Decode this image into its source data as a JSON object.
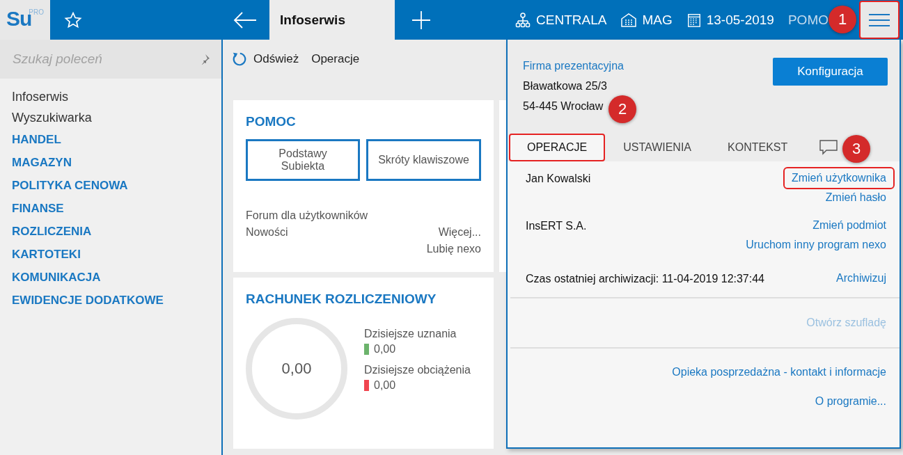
{
  "topbar": {
    "logo_main": "Su",
    "logo_sup": "PRO",
    "tab": "Infoserwis",
    "items": [
      {
        "kind": "branch",
        "label": "CENTRALA"
      },
      {
        "kind": "warehouse",
        "label": "MAG"
      },
      {
        "kind": "date",
        "label": "13-05-2019"
      },
      {
        "kind": "plain",
        "label": "POMO"
      }
    ],
    "menu_highlighted": true
  },
  "sidebar": {
    "search_placeholder": "Szukaj poleceń",
    "items": [
      {
        "label": "Infoserwis",
        "kind": "plain"
      },
      {
        "label": "Wyszukiwarka",
        "kind": "plain"
      },
      {
        "label": "HANDEL",
        "kind": "section"
      },
      {
        "label": "MAGAZYN",
        "kind": "section"
      },
      {
        "label": "POLITYKA CENOWA",
        "kind": "section"
      },
      {
        "label": "FINANSE",
        "kind": "section"
      },
      {
        "label": "ROZLICZENIA",
        "kind": "section"
      },
      {
        "label": "KARTOTEKI",
        "kind": "section"
      },
      {
        "label": "KOMUNIKACJA",
        "kind": "section"
      },
      {
        "label": "EWIDENCJE DODATKOWE",
        "kind": "section"
      }
    ]
  },
  "toolbar": {
    "refresh": "Odśwież",
    "operations": "Operacje"
  },
  "help_card": {
    "title": "POMOC",
    "buttons": [
      [
        "Podstawy",
        "Subiekta"
      ],
      [
        "Skróty klawiszowe"
      ]
    ],
    "forum": "Forum dla użytkowników",
    "news": "Nowości",
    "more": "Więcej...",
    "like": "Lubię nexo"
  },
  "account_card": {
    "title": "RACHUNEK ROZLICZENIOWY",
    "total": "0,00",
    "legend": [
      {
        "label": "Dzisiejsze uznania",
        "value": "0,00",
        "color": "#6cb36c"
      },
      {
        "label": "Dzisiejsze obciążenia",
        "value": "0,00",
        "color": "#f0454f"
      }
    ]
  },
  "panel": {
    "company": "Firma prezentacyjna",
    "address1": "Bławatkowa 25/3",
    "address2": "54-445 Wrocław",
    "config_button": "Konfiguracja",
    "tabs": [
      {
        "label": "OPERACJE",
        "selected": true,
        "highlighted": true
      },
      {
        "label": "USTAWIENIA",
        "selected": false,
        "highlighted": false
      },
      {
        "label": "KONTEKST",
        "selected": false,
        "highlighted": false
      }
    ],
    "user": "Jan Kowalski",
    "user_links": [
      {
        "label": "Zmień użytkownika",
        "highlighted": true
      },
      {
        "label": "Zmień hasło",
        "highlighted": false
      }
    ],
    "entity": "InsERT S.A.",
    "entity_links": [
      "Zmień podmiot",
      "Uruchom inny program nexo"
    ],
    "archive": "Czas ostatniej archiwizacji: 11-04-2019 12:37:44",
    "archive_link": "Archiwizuj",
    "drawer": {
      "label": "Otwórz szufladę",
      "disabled": true
    },
    "footer_links": [
      "Opieka posprzedażna - kontakt i informacje",
      "O programie..."
    ]
  },
  "callouts": [
    "1",
    "2",
    "3"
  ]
}
